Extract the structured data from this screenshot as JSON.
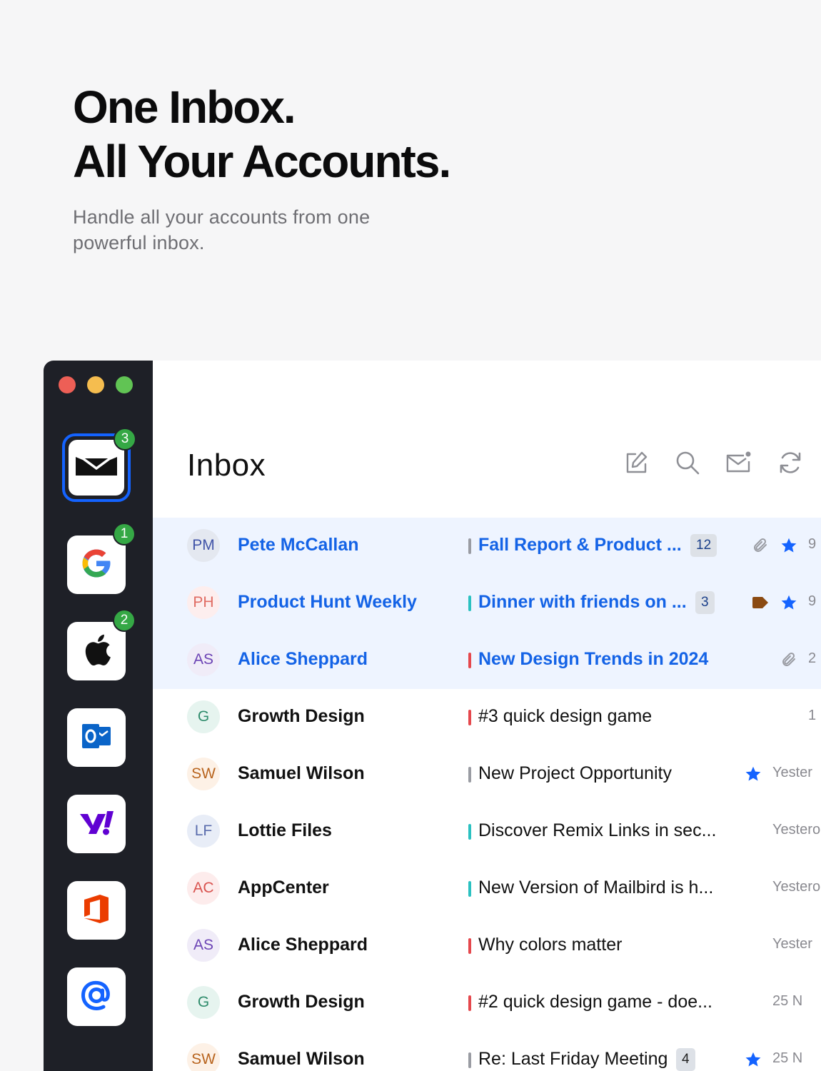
{
  "hero": {
    "title_line1": "One Inbox.",
    "title_line2": "All Your Accounts.",
    "subtitle": "Handle all your accounts from one powerful inbox."
  },
  "sidebar": {
    "accounts": [
      {
        "name": "unified-inbox",
        "icon": "envelope-icon",
        "badge": "3"
      },
      {
        "name": "google",
        "icon": "google-icon",
        "badge": "1"
      },
      {
        "name": "apple",
        "icon": "apple-icon",
        "badge": "2"
      },
      {
        "name": "outlook",
        "icon": "outlook-icon",
        "badge": ""
      },
      {
        "name": "yahoo",
        "icon": "yahoo-icon",
        "badge": ""
      },
      {
        "name": "office",
        "icon": "office-icon",
        "badge": ""
      },
      {
        "name": "other-mail",
        "icon": "at-icon",
        "badge": ""
      }
    ]
  },
  "header": {
    "title": "Inbox",
    "tools": [
      "compose-icon",
      "search-icon",
      "unread-mail-icon",
      "refresh-icon"
    ]
  },
  "colors": {
    "accent": "#1463ff",
    "unread_row_bg": "#eef4ff",
    "badge_green": "#35a845",
    "label_red": "#e5484d",
    "label_teal": "#2bc1c1",
    "label_gray": "#9a9ca3"
  },
  "emails": [
    {
      "initials": "PM",
      "sender": "Pete McCallan",
      "subject": "Fall Report & Product ...",
      "count": "12",
      "label_color": "#9a9ca3",
      "unread": true,
      "icons": [
        "paperclip-icon",
        "star-icon"
      ],
      "date": "9"
    },
    {
      "initials": "PH",
      "sender": "Product Hunt Weekly",
      "subject": "Dinner with friends on ...",
      "count": "3",
      "label_color": "#2bc1c1",
      "unread": true,
      "icons": [
        "tag-icon",
        "star-icon"
      ],
      "date": "9"
    },
    {
      "initials": "AS",
      "sender": "Alice Sheppard",
      "subject": "New Design Trends in 2024",
      "count": "",
      "label_color": "#e5484d",
      "unread": true,
      "icons": [
        "paperclip-icon"
      ],
      "date": "2"
    },
    {
      "initials": "G",
      "sender": "Growth Design",
      "subject": "#3 quick design game",
      "count": "",
      "label_color": "#e5484d",
      "unread": false,
      "icons": [],
      "date": "1"
    },
    {
      "initials": "SW",
      "sender": "Samuel Wilson",
      "subject": "New Project Opportunity",
      "count": "",
      "label_color": "#9a9ca3",
      "unread": false,
      "icons": [
        "star-icon"
      ],
      "date": "Yester"
    },
    {
      "initials": "LF",
      "sender": "Lottie Files",
      "subject": "Discover Remix Links in sec...",
      "count": "",
      "label_color": "#2bc1c1",
      "unread": false,
      "icons": [],
      "date": "Yestero"
    },
    {
      "initials": "AC",
      "sender": "AppCenter",
      "subject": "New Version of Mailbird is h...",
      "count": "",
      "label_color": "#2bc1c1",
      "unread": false,
      "icons": [],
      "date": "Yestero"
    },
    {
      "initials": "AS",
      "sender": "Alice Sheppard",
      "subject": "Why colors matter",
      "count": "",
      "label_color": "#e5484d",
      "unread": false,
      "icons": [],
      "date": "Yester"
    },
    {
      "initials": "G",
      "sender": "Growth Design",
      "subject": "#2 quick design game - doe...",
      "count": "",
      "label_color": "#e5484d",
      "unread": false,
      "icons": [],
      "date": "25 N"
    },
    {
      "initials": "SW",
      "sender": "Samuel Wilson",
      "subject": "Re: Last Friday Meeting",
      "count": "4",
      "label_color": "#9a9ca3",
      "unread": false,
      "icons": [
        "star-icon"
      ],
      "date": "25 N"
    }
  ]
}
